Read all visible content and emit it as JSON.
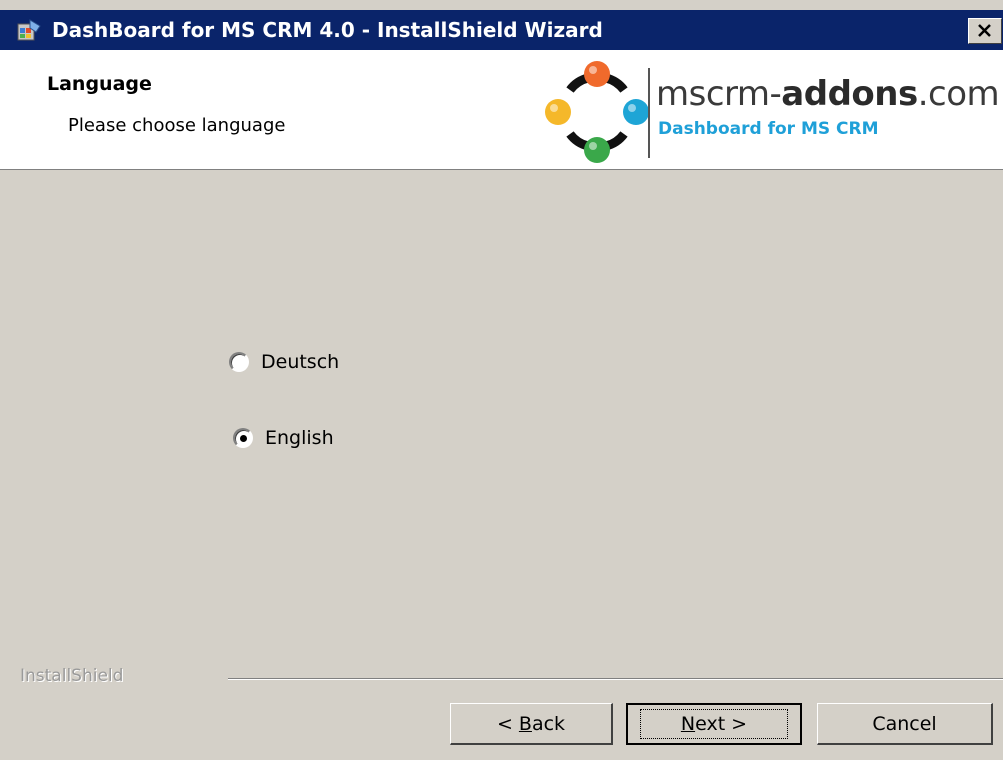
{
  "window": {
    "title": "DashBoard for MS CRM 4.0 - InstallShield Wizard",
    "close_glyph": "✕",
    "icon": "installer-icon"
  },
  "header": {
    "heading": "Language",
    "subheading": "Please choose language",
    "logo": {
      "text_prefix": "mscrm-",
      "text_bold": "addons",
      "text_suffix": ".com",
      "subtitle": "Dashboard for MS CRM"
    }
  },
  "options": [
    {
      "label": "Deutsch",
      "selected": false
    },
    {
      "label": "English",
      "selected": true
    }
  ],
  "footer": {
    "brand": "InstallShield",
    "back_label_mnemonic": "B",
    "back_label_rest": "ack",
    "back_prefix": "< ",
    "next_label_mnemonic": "N",
    "next_label_rest": "ext >",
    "cancel_label": "Cancel"
  },
  "colors": {
    "titlebar": "#0a246a",
    "dialog_bg": "#d4d0c8",
    "logo_accent": "#1fa0d8"
  }
}
